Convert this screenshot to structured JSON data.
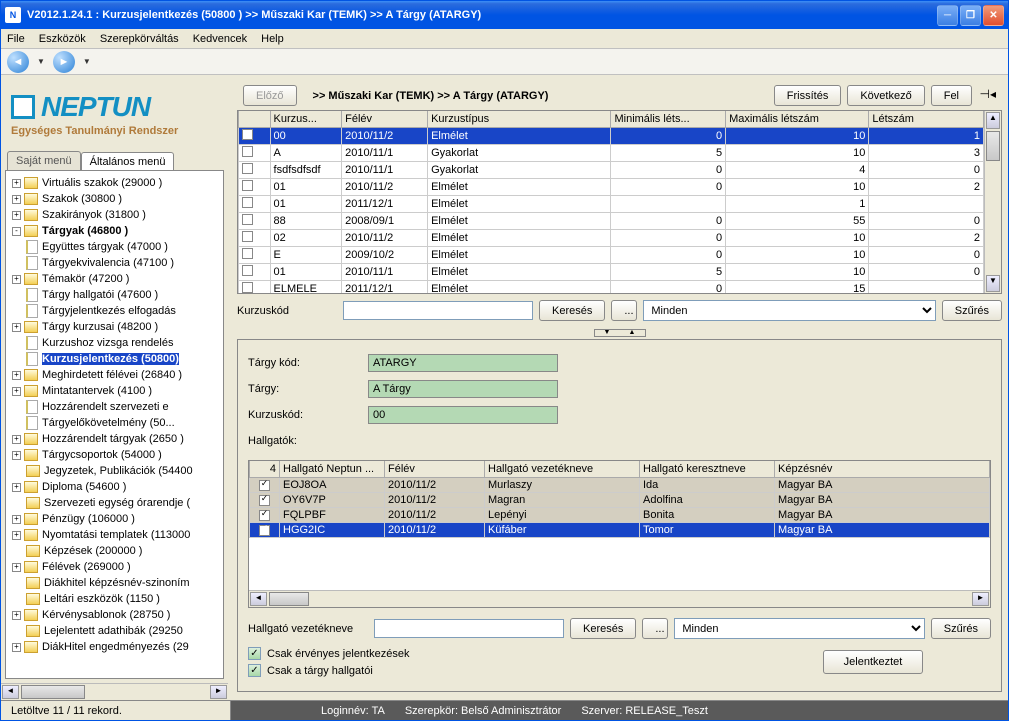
{
  "titlebar": {
    "text": "V2012.1.24.1 : Kurzusjelentkezés (50800  )   >> Műszaki Kar (TEMK) >> A Tárgy (ATARGY)"
  },
  "menubar": [
    "File",
    "Eszközök",
    "Szerepkörváltás",
    "Kedvencek",
    "Help"
  ],
  "logo": {
    "brand": "NEPTUN",
    "subtitle": "Egységes Tanulmányi Rendszer"
  },
  "tabs": {
    "own": "Saját menü",
    "general": "Általános menü"
  },
  "tree": [
    {
      "l": 1,
      "exp": "+",
      "t": "f",
      "label": "Virtuális szakok (29000  )"
    },
    {
      "l": 1,
      "exp": "+",
      "t": "f",
      "label": "Szakok (30800  )"
    },
    {
      "l": 1,
      "exp": "+",
      "t": "f",
      "label": "Szakirányok (31800  )"
    },
    {
      "l": 1,
      "exp": "-",
      "t": "f",
      "label": "Tárgyak (46800  )",
      "bold": true
    },
    {
      "l": 2,
      "exp": "",
      "t": "d",
      "label": "Együttes tárgyak (47000  )"
    },
    {
      "l": 2,
      "exp": "",
      "t": "d",
      "label": "Tárgyekvivalencia (47100  )"
    },
    {
      "l": 2,
      "exp": "+",
      "t": "f",
      "label": "Témakör (47200  )"
    },
    {
      "l": 2,
      "exp": "",
      "t": "d",
      "label": "Tárgy hallgatói (47600  )"
    },
    {
      "l": 2,
      "exp": "",
      "t": "d",
      "label": "Tárgyjelentkezés elfogadás"
    },
    {
      "l": 2,
      "exp": "+",
      "t": "f",
      "label": "Tárgy kurzusai (48200  )"
    },
    {
      "l": 2,
      "exp": "",
      "t": "d",
      "label": "Kurzushoz vizsga rendelés"
    },
    {
      "l": 2,
      "exp": "",
      "t": "d",
      "label": "Kurzusjelentkezés (50800)",
      "sel": true,
      "bold": true
    },
    {
      "l": 2,
      "exp": "+",
      "t": "f",
      "label": "Meghirdetett félévei (26840  )"
    },
    {
      "l": 2,
      "exp": "+",
      "t": "f",
      "label": "Mintatantervek (4100  )"
    },
    {
      "l": 2,
      "exp": "",
      "t": "d",
      "label": "Hozzárendelt szervezeti e"
    },
    {
      "l": 2,
      "exp": "",
      "t": "d",
      "label": "Tárgyelőkövetelmény (50..."
    },
    {
      "l": 1,
      "exp": "+",
      "t": "f",
      "label": "Hozzárendelt tárgyak (2650  )"
    },
    {
      "l": 1,
      "exp": "+",
      "t": "f",
      "label": "Tárgycsoportok (54000  )"
    },
    {
      "l": 1,
      "exp": "",
      "t": "f",
      "label": "Jegyzetek, Publikációk (54400"
    },
    {
      "l": 1,
      "exp": "+",
      "t": "f",
      "label": "Diploma (54600  )"
    },
    {
      "l": 1,
      "exp": "",
      "t": "f",
      "label": "Szervezeti egység órarendje ("
    },
    {
      "l": 1,
      "exp": "+",
      "t": "f",
      "label": "Pénzügy (106000  )"
    },
    {
      "l": 1,
      "exp": "+",
      "t": "f",
      "label": "Nyomtatási templatek (113000"
    },
    {
      "l": 1,
      "exp": "",
      "t": "f",
      "label": "Képzések (200000  )"
    },
    {
      "l": 1,
      "exp": "+",
      "t": "f",
      "label": "Félévek (269000  )"
    },
    {
      "l": 1,
      "exp": "",
      "t": "f",
      "label": "Diákhitel képzésnév-szinoním"
    },
    {
      "l": 1,
      "exp": "",
      "t": "f",
      "label": "Leltári eszközök (1150  )"
    },
    {
      "l": 1,
      "exp": "+",
      "t": "f",
      "label": "Kérvénysablonok (28750  )"
    },
    {
      "l": 1,
      "exp": "",
      "t": "f",
      "label": "Lejelentett adathibák (29250"
    },
    {
      "l": 1,
      "exp": "+",
      "t": "f",
      "label": "DiákHitel engedményezés (29"
    }
  ],
  "top": {
    "prev": "Előző",
    "breadcrumb": ">>  Műszaki Kar (TEMK) >> A Tárgy (ATARGY)",
    "refresh": "Frissítés",
    "next": "Következő",
    "up": "Fel"
  },
  "grid1": {
    "headers": [
      "",
      "Kurzus...",
      "Félév",
      "Kurzustípus",
      "Minimális léts...",
      "Maximális létszám",
      "Létszám"
    ],
    "rows": [
      {
        "sel": true,
        "c": [
          "00",
          "2010/11/2",
          "Elmélet",
          "0",
          "10",
          "1"
        ]
      },
      {
        "c": [
          "A",
          "2010/11/1",
          "Gyakorlat",
          "5",
          "10",
          "3"
        ]
      },
      {
        "c": [
          "fsdfsdfsdf",
          "2010/11/1",
          "Gyakorlat",
          "0",
          "4",
          "0"
        ]
      },
      {
        "c": [
          "01",
          "2010/11/2",
          "Elmélet",
          "0",
          "10",
          "2"
        ]
      },
      {
        "c": [
          "01",
          "2011/12/1",
          "Elmélet",
          "",
          "1",
          ""
        ]
      },
      {
        "c": [
          "88",
          "2008/09/1",
          "Elmélet",
          "0",
          "55",
          "0"
        ]
      },
      {
        "c": [
          "02",
          "2010/11/2",
          "Elmélet",
          "0",
          "10",
          "2"
        ]
      },
      {
        "c": [
          "E",
          "2009/10/2",
          "Elmélet",
          "0",
          "10",
          "0"
        ]
      },
      {
        "c": [
          "01",
          "2010/11/1",
          "Elmélet",
          "5",
          "10",
          "0"
        ]
      },
      {
        "c": [
          "ELMELE",
          "2011/12/1",
          "Elmélet",
          "0",
          "15",
          ""
        ]
      }
    ]
  },
  "search1": {
    "label": "Kurzuskód",
    "btn": "Keresés",
    "dots": "...",
    "filter_sel": "Minden",
    "filter_btn": "Szűrés"
  },
  "details": {
    "code_l": "Tárgy kód:",
    "code_v": "ATARGY",
    "name_l": "Tárgy:",
    "name_v": "A Tárgy",
    "kurz_l": "Kurzuskód:",
    "kurz_v": "00",
    "stud_l": "Hallgatók:"
  },
  "grid2": {
    "headers": [
      "4",
      "Hallgató Neptun ...",
      "Félév",
      "Hallgató vezetékneve",
      "Hallgató keresztneve",
      "Képzésnév"
    ],
    "rows": [
      {
        "chk": true,
        "c": [
          "EOJ8OA",
          "2010/11/2",
          "Murlaszy",
          "Ida",
          "Magyar BA"
        ]
      },
      {
        "chk": true,
        "c": [
          "OY6V7P",
          "2010/11/2",
          "Magran",
          "Adolfina",
          "Magyar BA"
        ]
      },
      {
        "chk": true,
        "c": [
          "FQLPBF",
          "2010/11/2",
          "Lepényi",
          "Bonita",
          "Magyar BA"
        ]
      },
      {
        "sel": true,
        "chk": true,
        "c": [
          "HGG2IC",
          "2010/11/2",
          "Küfáber",
          "Tomor",
          "Magyar BA"
        ]
      }
    ]
  },
  "search2": {
    "label": "Hallgató vezetékneve",
    "btn": "Keresés",
    "dots": "...",
    "filter_sel": "Minden",
    "filter_btn": "Szűrés"
  },
  "checks": {
    "c1": "Csak érvényes jelentkezések",
    "c2": "Csak a tárgy hallgatói"
  },
  "action_btn": "Jelentkeztet",
  "status": {
    "loaded": "Letöltve 11 / 11 rekord.",
    "login": "Loginnév: TA",
    "role": "Szerepkör: Belső Adminisztrátor",
    "server": "Szerver: RELEASE_Teszt"
  }
}
